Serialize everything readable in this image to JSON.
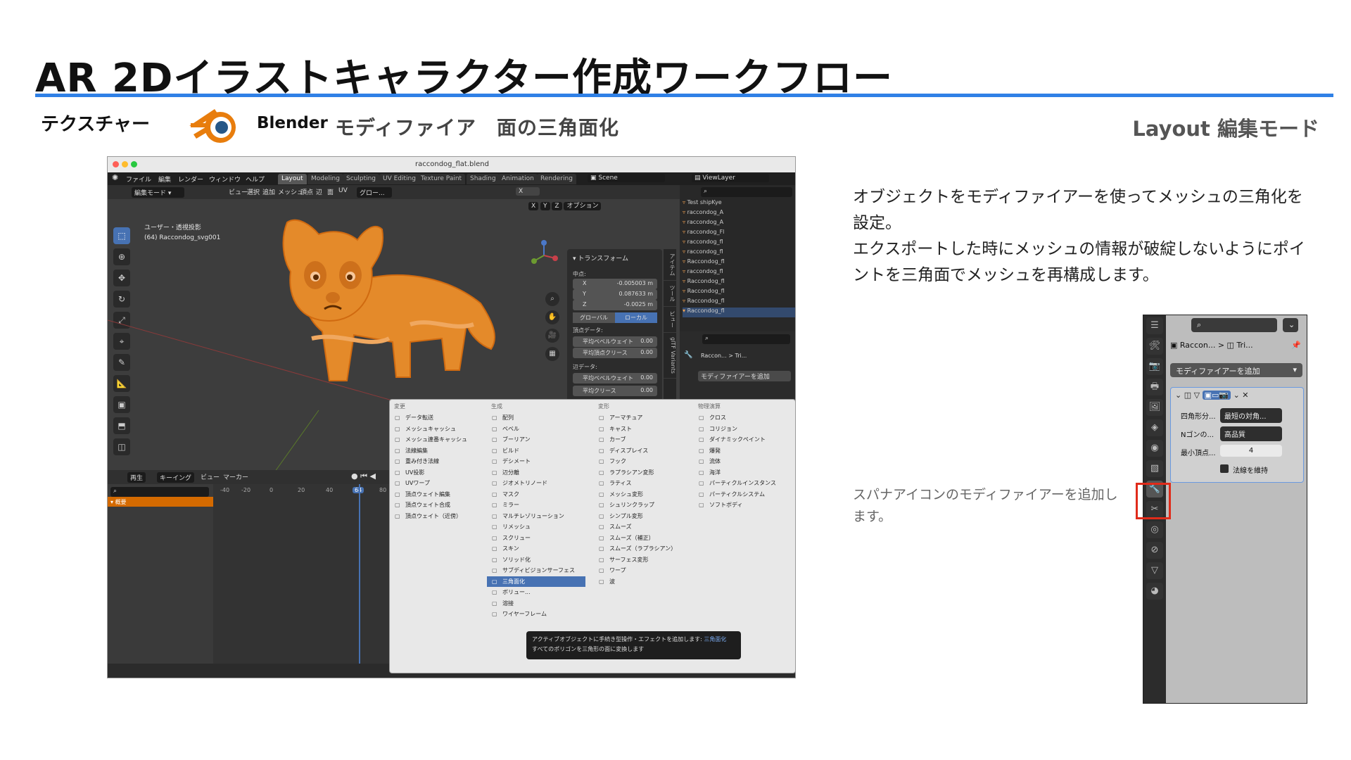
{
  "slide": {
    "title": "AR 2Dイラストキャラクター作成ワークフロー",
    "section": "テクスチャー",
    "app_name": "Blender",
    "step": "モディファイア　面の三角面化",
    "mode": "Layout 編集モード",
    "accent_color": "#2f80e6"
  },
  "description": {
    "p1": "オブジェクトをモディファイアーを使ってメッシュの三角化を設定。",
    "p2": "エクスポートした時にメッシュの情報が破綻しないようにポイントを三角面でメッシュを再構成します。"
  },
  "note": "スパナアイコンのモディファイアーを追加します。",
  "blender": {
    "window_title": "raccondog_flat.blend",
    "menu": [
      "ファイル",
      "編集",
      "レンダー",
      "ウィンドウ",
      "ヘルプ"
    ],
    "workspaces": [
      "Layout",
      "Modeling",
      "Sculpting",
      "UV Editing",
      "Texture Paint",
      "Shading",
      "Animation",
      "Rendering"
    ],
    "scene": "Scene",
    "view_layer": "ViewLayer",
    "header": {
      "mode": "編集モード",
      "view_menus": [
        "ビュー",
        "選択",
        "追加",
        "メッシュ",
        "頂点",
        "辺",
        "面",
        "UV"
      ],
      "transform_orient": "グロー...",
      "options": "オプション",
      "axes": [
        "X",
        "Y",
        "Z"
      ]
    },
    "viewport_info": {
      "view": "ユーザー・透視投影",
      "object": "(64) Raccondog_svg001"
    },
    "npanel": {
      "header": "トランスフォーム",
      "median_label": "中点:",
      "fields": [
        {
          "key": "X",
          "value": "-0.005003 m"
        },
        {
          "key": "Y",
          "value": "0.087633 m"
        },
        {
          "key": "Z",
          "value": "-0.0025 m"
        }
      ],
      "toggle": [
        "グローバル",
        "ローカル"
      ],
      "vertex_data": "頂点データ:",
      "vertex_fields": [
        {
          "key": "平均ベベルウェイト",
          "value": "0.00"
        },
        {
          "key": "平均頂点クリース",
          "value": "0.00"
        }
      ],
      "edge_data": "辺データ:",
      "edge_fields": [
        {
          "key": "平均ベベルウェイト",
          "value": "0.00"
        },
        {
          "key": "平均クリース",
          "value": "0.00"
        }
      ],
      "tabs": [
        "アイテム",
        "ツール",
        "ビュー",
        "glTF Variants"
      ]
    },
    "outliner": [
      "Test shipKye",
      "raccondog_A",
      "raccondog_A",
      "raccondog_Fl",
      "raccondog_fl",
      "raccondog_fl",
      "Raccondog_fl",
      "raccondog_fl",
      "Raccondog_fl",
      "Raccondog_fl",
      "Raccondog_fl",
      "Raccondog_fl"
    ],
    "props_small": {
      "object": "Raccon...",
      "mesh": "Tri...",
      "add_modifier": "モディファイアーを追加"
    },
    "timeline": {
      "play": "再生",
      "keying": "キーイング",
      "view": "ビュー",
      "marker": "マーカー",
      "summary": "概要",
      "frames": [
        "-40",
        "-20",
        "0",
        "20",
        "40",
        "64",
        "80"
      ],
      "current_frame": "64"
    },
    "modifier_menu": {
      "columns": [
        {
          "header": "変更",
          "items": [
            "データ転送",
            "メッシュキャッシュ",
            "メッシュ連番キャッシュ",
            "法線編集",
            "重み付き法線",
            "UV投影",
            "UVワープ",
            "頂点ウェイト編集",
            "頂点ウェイト合成",
            "頂点ウェイト（近傍）"
          ]
        },
        {
          "header": "生成",
          "items": [
            "配列",
            "ベベル",
            "ブーリアン",
            "ビルド",
            "デシメート",
            "辺分離",
            "ジオメトリノード",
            "マスク",
            "ミラー",
            "マルチレゾリューション",
            "リメッシュ",
            "スクリュー",
            "スキン",
            "ソリッド化",
            "サブディビジョンサーフェス",
            "三角面化",
            "ボリュー...",
            "溶接",
            "ワイヤーフレーム"
          ]
        },
        {
          "header": "変形",
          "items": [
            "アーマチュア",
            "キャスト",
            "カーブ",
            "ディスプレイス",
            "フック",
            "ラプラシアン変形",
            "ラティス",
            "メッシュ変形",
            "シュリンクラップ",
            "シンプル変形",
            "スムーズ",
            "スムーズ（補正）",
            "スムーズ（ラプラシアン）",
            "サーフェス変形",
            "ワープ",
            "波"
          ]
        },
        {
          "header": "物理演算",
          "items": [
            "クロス",
            "コリジョン",
            "ダイナミックペイント",
            "爆発",
            "流体",
            "海洋",
            "パーティクルインスタンス",
            "パーティクルシステム",
            "ソフトボディ"
          ]
        }
      ],
      "selected": "三角面化",
      "tooltip_line1": "アクティブオブジェクトに手続き型操作・エフェクトを追加します:",
      "tooltip_hl": "三角面化",
      "tooltip_line2": "すべてのポリゴンを三角形の面に変換します"
    }
  },
  "properties_panel": {
    "object": "Raccon...",
    "mesh": "Tri...",
    "add_modifier": "モディファイアーを追加",
    "fields": [
      {
        "label": "四角形分...",
        "value": "最短の対角..."
      },
      {
        "label": "Nゴンの...",
        "value": "高品質"
      },
      {
        "label": "最小頂点...",
        "value": "4"
      }
    ],
    "keep_normals": "法線を維持",
    "highlight_color": "#e02b1a"
  }
}
